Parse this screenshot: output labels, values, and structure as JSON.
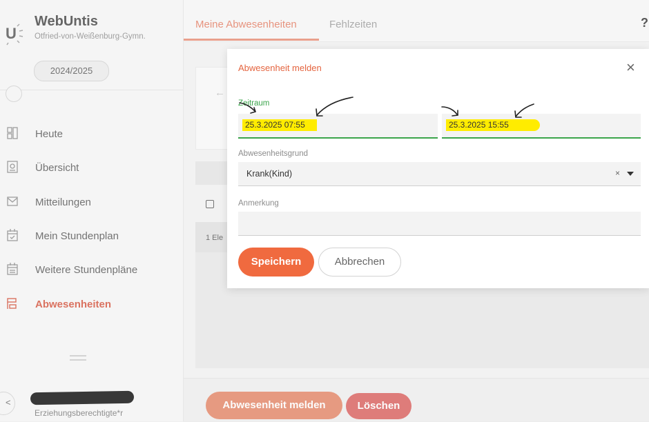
{
  "sidebar": {
    "app_name": "WebUntis",
    "school": "Otfried-von-Weißenburg-Gymn.",
    "year": "2024/2025",
    "items": [
      {
        "label": "Heute",
        "icon": "today-icon"
      },
      {
        "label": "Übersicht",
        "icon": "overview-icon"
      },
      {
        "label": "Mitteilungen",
        "icon": "messages-icon"
      },
      {
        "label": "Mein Stundenplan",
        "icon": "timetable-icon"
      },
      {
        "label": "Weitere Stundenpläne",
        "icon": "more-timetables-icon"
      },
      {
        "label": "Abwesenheiten",
        "icon": "absences-icon",
        "active": true
      }
    ],
    "user_role": "Erziehungsberechtigte*r"
  },
  "header": {
    "tabs": [
      {
        "label": "Meine Abwesenheiten",
        "active": true
      },
      {
        "label": "Fehlzeiten",
        "active": false
      }
    ],
    "help": "?"
  },
  "main": {
    "row_count_partial": "1 Ele"
  },
  "footer": {
    "report_label": "Abwesenheit melden",
    "delete_label": "Löschen"
  },
  "modal": {
    "title": "Abwesenheit melden",
    "close": "×",
    "zeitraum_label": "Zeitraum",
    "start": "25.3.2025 07:55",
    "end": "25.3.2025 15:55",
    "reason_label": "Abwesenheitsgrund",
    "reason_value": "Krank(Kind)",
    "reason_clear": "×",
    "note_label": "Anmerkung",
    "note_value": "",
    "save_label": "Speichern",
    "cancel_label": "Abbrechen"
  },
  "colors": {
    "accent": "#e4643f",
    "valid": "#3aa44a",
    "highlight": "#ffec00",
    "active_nav": "#d2543d"
  }
}
